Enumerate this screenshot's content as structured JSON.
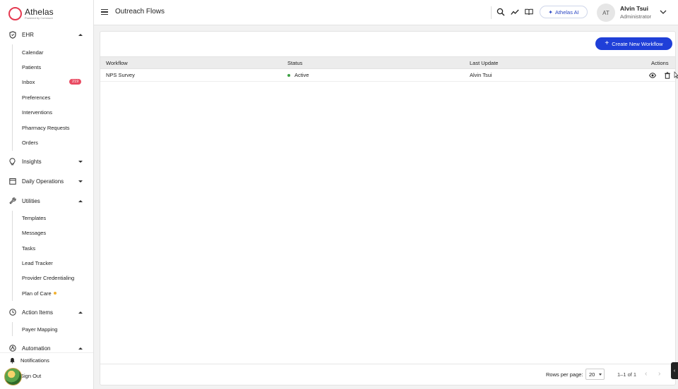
{
  "brand": {
    "name": "Athelas",
    "tagline": "Powered by Commure",
    "accent": "#e53950"
  },
  "sidebar": {
    "sections": [
      {
        "label": "EHR",
        "icon": "shield-icon",
        "expanded": true,
        "items": [
          "Calendar",
          "Patients",
          "Inbox",
          "Preferences",
          "Interventions",
          "Pharmacy Requests",
          "Orders"
        ]
      },
      {
        "label": "Insights",
        "icon": "lightbulb-icon",
        "expanded": false
      },
      {
        "label": "Daily Operations",
        "icon": "calendar-icon",
        "expanded": false
      },
      {
        "label": "Utilities",
        "icon": "wrench-icon",
        "expanded": true,
        "items": [
          "Templates",
          "Messages",
          "Tasks",
          "Lead Tracker",
          "Provider Credentialing",
          "Plan of Care"
        ]
      },
      {
        "label": "Action Items",
        "icon": "clock-icon",
        "expanded": true,
        "items": [
          "Payer Mapping"
        ]
      },
      {
        "label": "Automation",
        "icon": "automation-icon",
        "expanded": true
      }
    ],
    "inbox_badge": "219",
    "bottom": {
      "notifications": "Notifications",
      "sign_out": "Sign Out"
    }
  },
  "topbar": {
    "title": "Outreach Flows",
    "ai_button": "Athelas AI",
    "user": {
      "initials": "AT",
      "name": "Alvin Tsui",
      "role": "Administrator"
    }
  },
  "main": {
    "create_button": "Create New Workflow",
    "columns": [
      "Workflow",
      "Status",
      "Last Update",
      "Actions"
    ],
    "rows": [
      {
        "workflow": "NPS Survey",
        "status": "Active",
        "last_update": "Alvin Tsui"
      }
    ],
    "footer": {
      "rows_per_page_label": "Rows per page:",
      "rows_per_page": "20",
      "range": "1–1 of 1"
    }
  },
  "colors": {
    "primary": "#1f3fd8",
    "active_status": "#3ca043",
    "badge": "#e94b62",
    "plan_of_care_dot": "#f2b233"
  }
}
